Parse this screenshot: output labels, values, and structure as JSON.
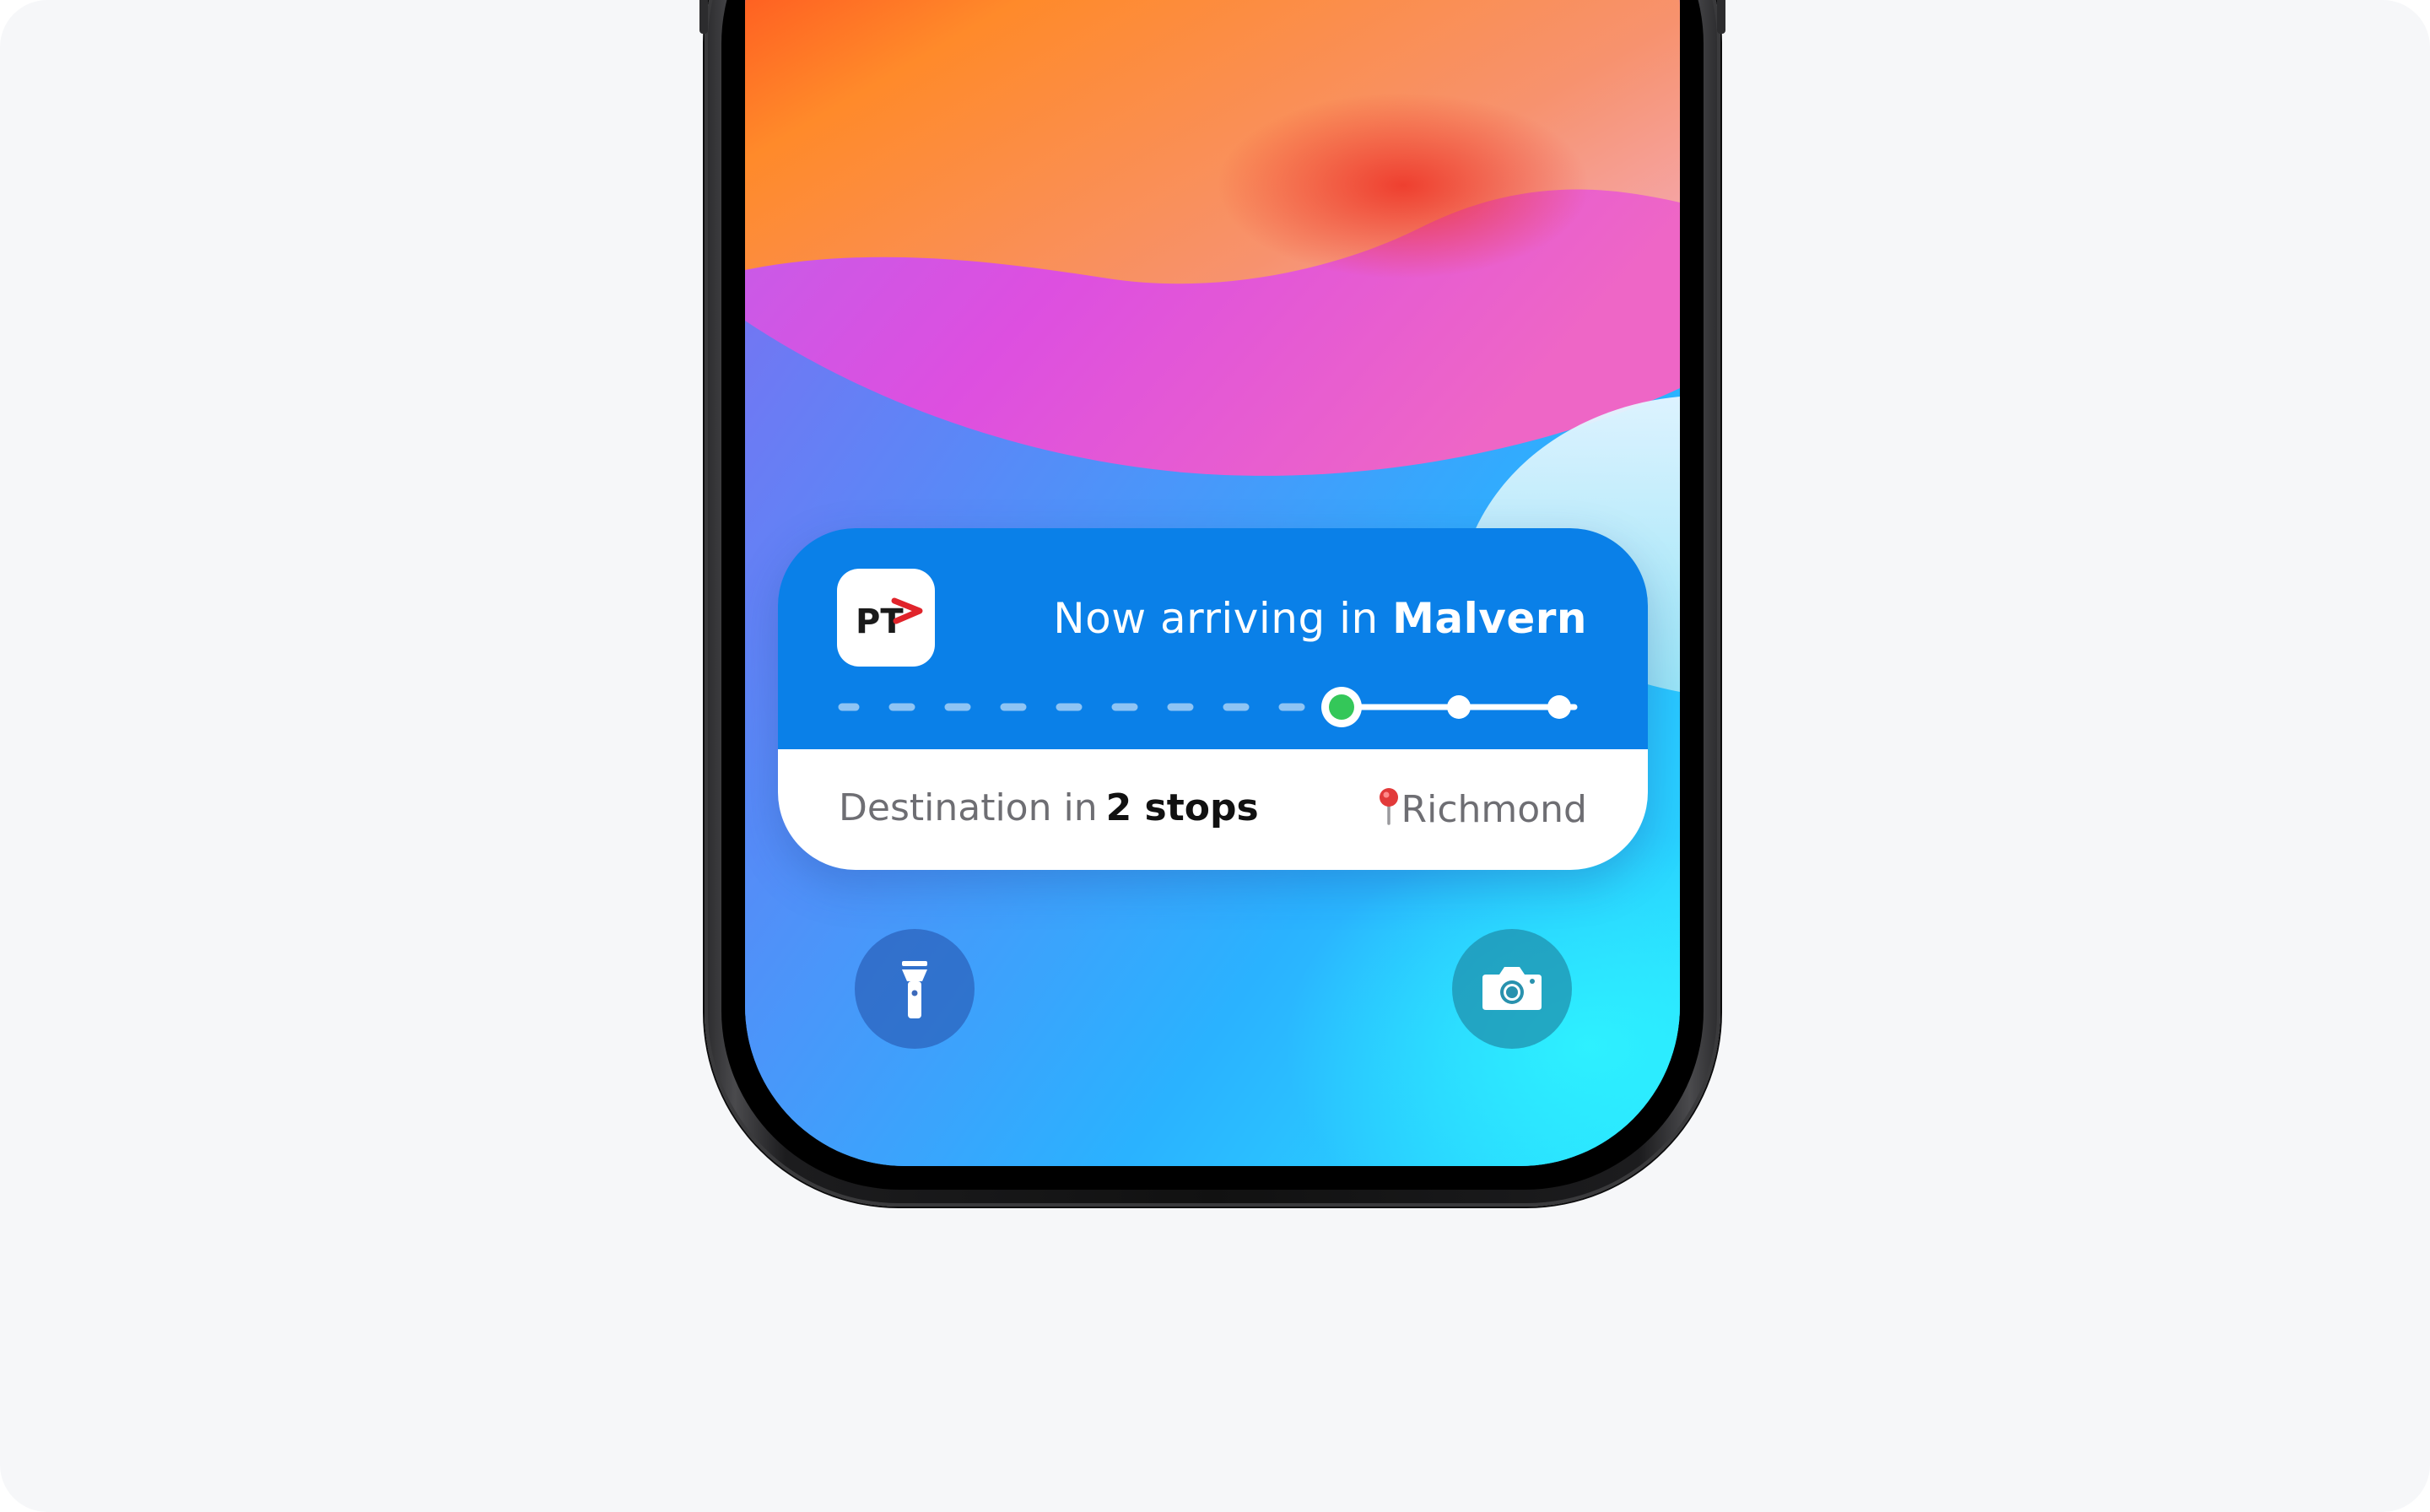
{
  "app_icon": {
    "name": "pt-app-icon",
    "brand_text": "PT",
    "brand_colors": {
      "text": "#1a1a1a",
      "arrow": "#e0242b"
    }
  },
  "live_activity": {
    "headline_prefix": "Now arriving in",
    "headline_station": "Malvern",
    "destination_prefix": "Destination in",
    "destination_stops": "2 stops",
    "destination_place": "Richmond",
    "destination_icon": "map-pin-icon",
    "colors": {
      "header": "#0a80e8",
      "current_stop": "#34c759",
      "body": "#ffffff"
    },
    "progress": {
      "completed_segments": 9,
      "current_stop_index": 0,
      "remaining_stops": 2
    }
  },
  "lock_screen": {
    "flashlight_icon": "flashlight-icon",
    "camera_icon": "camera-icon"
  }
}
